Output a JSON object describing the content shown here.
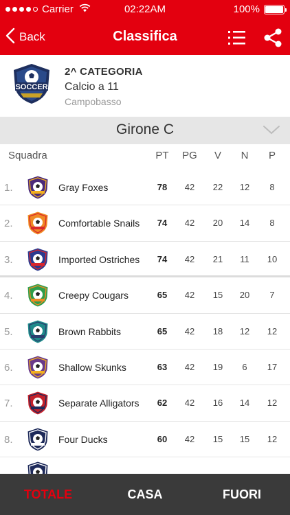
{
  "status_bar": {
    "carrier": "Carrier",
    "time": "02:22AM",
    "battery": "100%"
  },
  "nav": {
    "back_label": "Back",
    "title": "Classifica"
  },
  "league": {
    "category": "2^ CATEGORIA",
    "type": "Calcio a 11",
    "city": "Campobasso",
    "logo_text": "SOCCER"
  },
  "group": {
    "title": "Girone C"
  },
  "table": {
    "headers": {
      "team": "Squadra",
      "pt": "PT",
      "pg": "PG",
      "v": "V",
      "n": "N",
      "p": "P"
    },
    "rows": [
      {
        "pos": "1.",
        "team": "Gray Foxes",
        "pt": "78",
        "pg": "42",
        "v": "22",
        "n": "12",
        "p": "8",
        "badge_color": "#4b2a7a",
        "badge_accent": "#f2b01e"
      },
      {
        "pos": "2.",
        "team": "Comfortable Snails",
        "pt": "74",
        "pg": "42",
        "v": "20",
        "n": "14",
        "p": "8",
        "badge_color": "#f08a24",
        "badge_accent": "#d92a2a"
      },
      {
        "pos": "3.",
        "team": "Imported Ostriches",
        "pt": "74",
        "pg": "42",
        "v": "21",
        "n": "11",
        "p": "10",
        "badge_color": "#2b3a8f",
        "badge_accent": "#d9262c"
      },
      {
        "pos": "4.",
        "team": "Creepy Cougars",
        "pt": "65",
        "pg": "42",
        "v": "15",
        "n": "20",
        "p": "7",
        "badge_color": "#2f9e4a",
        "badge_accent": "#f08a24"
      },
      {
        "pos": "5.",
        "team": "Brown Rabbits",
        "pt": "65",
        "pg": "42",
        "v": "18",
        "n": "12",
        "p": "12",
        "badge_color": "#1f8a8a",
        "badge_accent": "#2a3f6e"
      },
      {
        "pos": "6.",
        "team": "Shallow Skunks",
        "pt": "63",
        "pg": "42",
        "v": "19",
        "n": "6",
        "p": "17",
        "badge_color": "#6a3a8a",
        "badge_accent": "#f2b01e"
      },
      {
        "pos": "7.",
        "team": "Separate Alligators",
        "pt": "62",
        "pg": "42",
        "v": "16",
        "n": "14",
        "p": "12",
        "badge_color": "#c4202a",
        "badge_accent": "#1e2a5a"
      },
      {
        "pos": "8.",
        "team": "Four Ducks",
        "pt": "60",
        "pg": "42",
        "v": "15",
        "n": "15",
        "p": "12",
        "badge_color": "#1e2a5a",
        "badge_accent": "#ffffff"
      }
    ]
  },
  "tabs": {
    "totale": "TOTALE",
    "casa": "CASA",
    "fuori": "FUORI"
  },
  "colors": {
    "brand_red": "#e3000f",
    "tabbar_bg": "#3a3a3a"
  }
}
